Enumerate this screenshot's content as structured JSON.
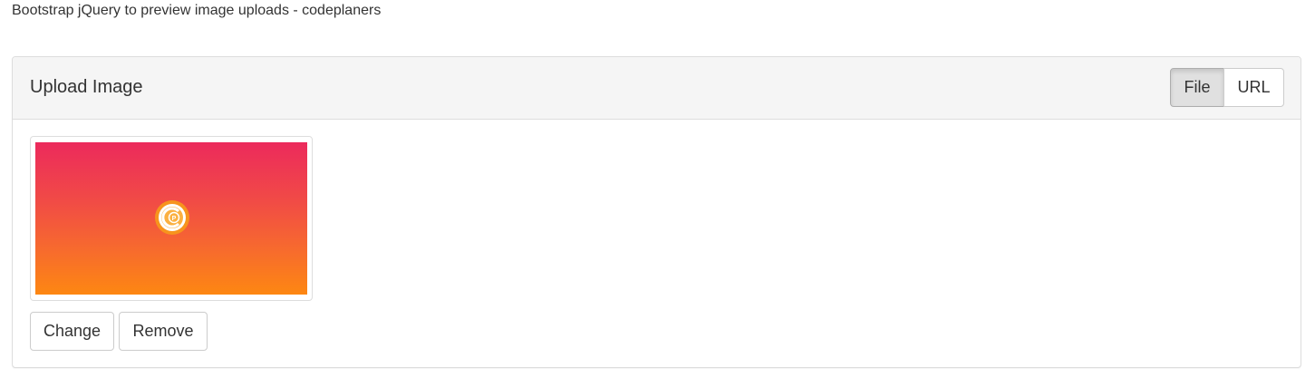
{
  "page": {
    "title": "Bootstrap jQuery to preview image uploads - codeplaners"
  },
  "panel": {
    "title": "Upload Image",
    "source_toggle": {
      "file_label": "File",
      "url_label": "URL",
      "active": "File"
    }
  },
  "preview": {
    "image_alt": "uploaded image preview",
    "logo_icon": "codeplaners-logo-icon",
    "gradient_top": "#ec2a5c",
    "gradient_bottom": "#fd8712"
  },
  "actions": {
    "change_label": "Change",
    "remove_label": "Remove"
  }
}
